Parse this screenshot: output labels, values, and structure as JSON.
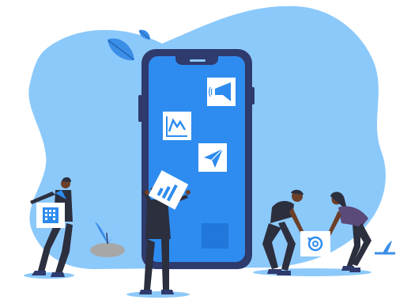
{
  "colors": {
    "blob": "#8cc9fb",
    "phone_frame": "#2f3a6d",
    "phone_screen": "#2e8cf0",
    "tile_bg": "#ffffff",
    "accent_dark": "#2a4a8a",
    "skin_dark": "#6b3f2a",
    "clothing_dark": "#2c2f3e",
    "plant": "#3b8ee8",
    "rock": "#a7a7a7"
  },
  "icons": [
    "megaphone-icon",
    "line-chart-icon",
    "paper-plane-icon",
    "bar-chart-icon",
    "building-icon",
    "sync-icon",
    "leaf-icon",
    "plant-icon"
  ]
}
